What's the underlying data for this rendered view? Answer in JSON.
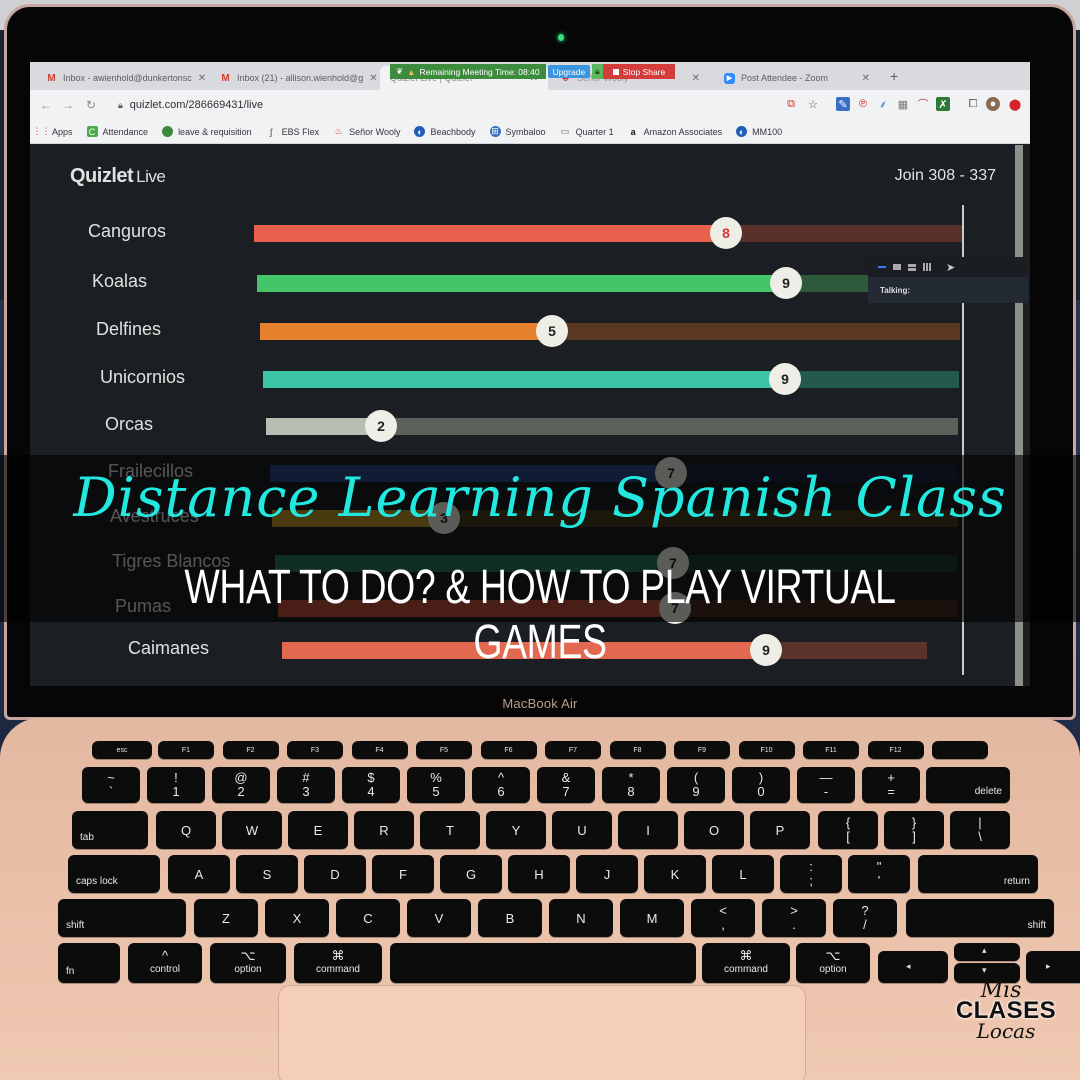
{
  "browser": {
    "tabs": [
      {
        "label": "Inbox - awienhold@dunkertonsc",
        "icon": "gmail-icon",
        "active": false
      },
      {
        "label": "Inbox (21) - allison.wienhold@g",
        "icon": "gmail-icon",
        "active": false
      },
      {
        "label": "Quizlet Live | Quizlet",
        "icon": "quizlet-icon",
        "active": true
      },
      {
        "label": "Señor Wooly",
        "icon": "senor-wooly-icon",
        "active": false
      },
      {
        "label": "Post Attendee - Zoom",
        "icon": "zoom-icon",
        "active": false
      }
    ],
    "url": "quizlet.com/286669431/live",
    "bookmarks": [
      {
        "label": "Apps",
        "icon": "apps-grid-icon"
      },
      {
        "label": "Attendance",
        "icon": "attendance-icon"
      },
      {
        "label": "leave & requisition",
        "icon": "globe-icon"
      },
      {
        "label": "EBS Flex",
        "icon": "ebs-icon"
      },
      {
        "label": "Señor Wooly",
        "icon": "senor-wooly-icon"
      },
      {
        "label": "Beachbody",
        "icon": "beachbody-icon"
      },
      {
        "label": "Symbaloo",
        "icon": "symbaloo-icon"
      },
      {
        "label": "Quarter 1",
        "icon": "folder-icon"
      },
      {
        "label": "Amazon Associates",
        "icon": "amazon-icon"
      },
      {
        "label": "MM100",
        "icon": "mm100-icon"
      }
    ]
  },
  "zoom_bar": {
    "remaining_label": "Remaining Meeting Time: 08:40",
    "upgrade_label": "Upgrade",
    "stop_share_label": "Stop Share",
    "talking_label": "Talking:"
  },
  "quizlet": {
    "logo": "Quizlet",
    "logo_suffix": "Live",
    "join_text": "Join 308 - 337",
    "max_score": 12,
    "teams": [
      {
        "name": "Canguros",
        "score": 8,
        "color": "#e8604b",
        "track": "#5a302b",
        "score_color": "#d8353a"
      },
      {
        "name": "Koalas",
        "score": 9,
        "color": "#44c56a",
        "track": "#2c5a3a"
      },
      {
        "name": "Delfines",
        "score": 5,
        "color": "#e6822d",
        "track": "#5a3720"
      },
      {
        "name": "Unicornios",
        "score": 9,
        "color": "#3cc4a6",
        "track": "#245a4e"
      },
      {
        "name": "Orcas",
        "score": 2,
        "color": "#b6bfb2",
        "track": "#5b605a"
      },
      {
        "name": "Frailecillos",
        "score": 7,
        "color": "#2c4a8a",
        "track": "#1d2740"
      },
      {
        "name": "Avestruces",
        "score": 3,
        "color": "#c19a2c",
        "track": "#4a3e1e"
      },
      {
        "name": "Tigres Blancos",
        "score": 7,
        "color": "#2d7a64",
        "track": "#1f4038"
      },
      {
        "name": "Pumas",
        "score": 7,
        "color": "#c0503c",
        "track": "#4b2a24"
      },
      {
        "name": "Caimanes",
        "score": 9,
        "color": "#e2694f",
        "track": "#5a332c"
      }
    ]
  },
  "overlay": {
    "script_title": "Distance Learning Spanish Class",
    "subtitle": "What to do? & How to Play Virtual Games"
  },
  "device_label": "MacBook Air",
  "keyboard": {
    "fn_row": [
      "esc",
      "F1",
      "F2",
      "F3",
      "F4",
      "F5",
      "F6",
      "F7",
      "F8",
      "F9",
      "F10",
      "F11",
      "F12",
      ""
    ],
    "num_row": [
      [
        "~",
        "`"
      ],
      [
        "!",
        "1"
      ],
      [
        "@",
        "2"
      ],
      [
        "#",
        "3"
      ],
      [
        "$",
        "4"
      ],
      [
        "%",
        "5"
      ],
      [
        "^",
        "6"
      ],
      [
        "&",
        "7"
      ],
      [
        "*",
        "8"
      ],
      [
        "(",
        "9"
      ],
      [
        ")",
        "0"
      ],
      [
        "—",
        "-"
      ],
      [
        "+",
        "="
      ]
    ],
    "delete": "delete",
    "tab": "tab",
    "qwerty": [
      "Q",
      "W",
      "E",
      "R",
      "T",
      "Y",
      "U",
      "I",
      "O",
      "P"
    ],
    "brackets": [
      [
        "{",
        "["
      ],
      [
        "}",
        "]"
      ],
      [
        "|",
        "\\"
      ]
    ],
    "caps": "caps lock",
    "asdf": [
      "A",
      "S",
      "D",
      "F",
      "G",
      "H",
      "J",
      "K",
      "L"
    ],
    "semi": [
      [
        ":",
        ";"
      ],
      [
        "\"",
        "'"
      ]
    ],
    "return": "return",
    "shift": "shift",
    "zxcv": [
      "Z",
      "X",
      "C",
      "V",
      "B",
      "N",
      "M"
    ],
    "punct": [
      [
        "<",
        ","
      ],
      [
        ">",
        "."
      ],
      [
        "?",
        "/"
      ]
    ],
    "bottom": {
      "fn": "fn",
      "control": "control",
      "option": "option",
      "command": "command",
      "control_sym": "^",
      "option_sym": "⌥",
      "command_sym": "⌘"
    }
  },
  "brand": {
    "line1": "Mis",
    "line2": "CLASES",
    "line3": "Locas"
  }
}
